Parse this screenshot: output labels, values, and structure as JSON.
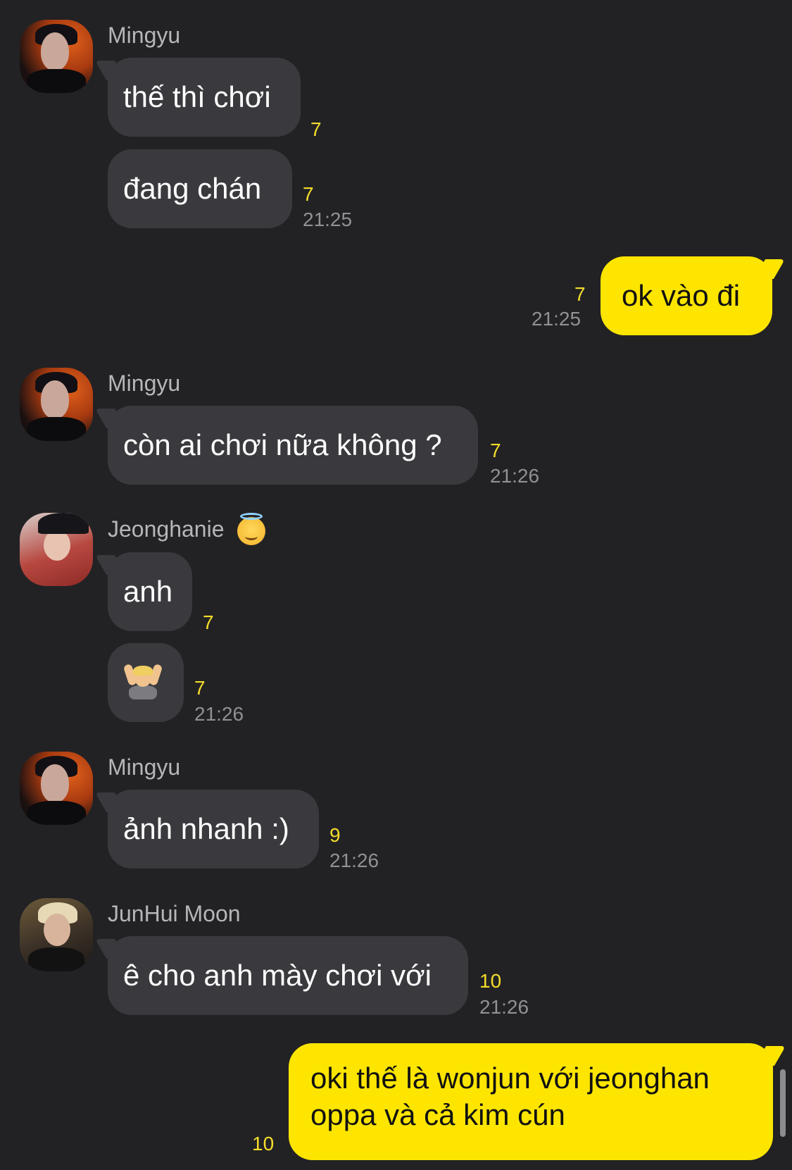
{
  "messages": [
    {
      "sender": "Mingyu",
      "text": "thế thì chơi",
      "unread": "7"
    },
    {
      "text": "đang chán",
      "unread": "7",
      "time": "21:25"
    },
    {
      "own": true,
      "text": "ok vào đi",
      "unread": "7",
      "time": "21:25"
    },
    {
      "sender": "Mingyu",
      "text": "còn ai chơi nữa không ?",
      "unread": "7",
      "time": "21:26"
    },
    {
      "sender": "Jeonghanie",
      "text": "anh",
      "unread": "7"
    },
    {
      "sticker": "person-gesturing-ok-emoji",
      "unread": "7",
      "time": "21:26"
    },
    {
      "sender": "Mingyu",
      "text": "ảnh nhanh :)",
      "unread": "9",
      "time": "21:26"
    },
    {
      "sender": "JunHui Moon",
      "text": "ê cho anh mày chơi với",
      "unread": "10",
      "time": "21:26"
    },
    {
      "own": true,
      "lines": [
        "oki thế là wonjun với jeonghan",
        "oppa và cả kim cún"
      ],
      "unread": "10"
    }
  ],
  "icons": {
    "name_emoji": "smiling-face-with-halo-emoji",
    "sticker": "person-gesturing-ok-emoji"
  },
  "colors": {
    "background": "#222225",
    "incoming_bubble": "#3a3a3e",
    "outgoing_bubble": "#fee500",
    "unread_count": "#f5dd2a",
    "timestamp": "#909095"
  }
}
